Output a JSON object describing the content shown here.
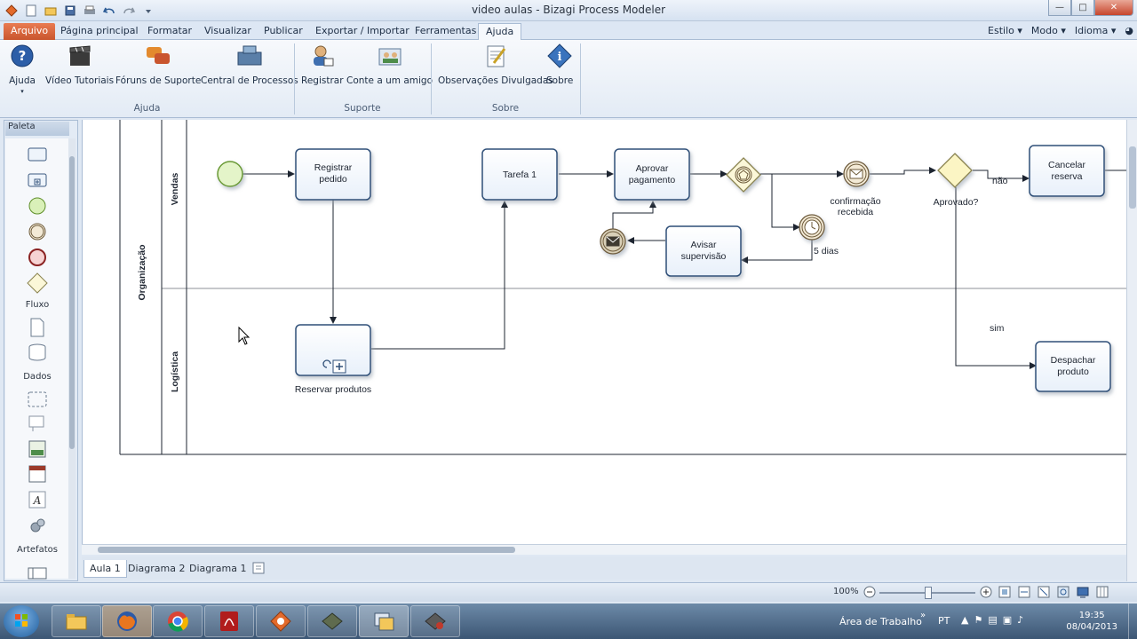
{
  "window": {
    "title": "video aulas - Bizagi Process Modeler"
  },
  "ribbon_tabs": [
    {
      "label": "Arquivo"
    },
    {
      "label": "Página principal"
    },
    {
      "label": "Formatar"
    },
    {
      "label": "Visualizar"
    },
    {
      "label": "Publicar"
    },
    {
      "label": "Exportar / Importar"
    },
    {
      "label": "Ferramentas"
    },
    {
      "label": "Ajuda"
    }
  ],
  "ribbon_right": {
    "estilo": "Estilo",
    "modo": "Modo",
    "idioma": "Idioma"
  },
  "ribbon": {
    "buttons": [
      {
        "label": "Ajuda",
        "icon": "help-icon"
      },
      {
        "label": "Vídeo Tutoriais",
        "icon": "clapperboard-icon"
      },
      {
        "label": "Fóruns de Suporte",
        "icon": "forum-icon"
      },
      {
        "label": "Central de Processos",
        "icon": "process-central-icon"
      },
      {
        "label": "Registrar",
        "icon": "register-user-icon"
      },
      {
        "label": "Conte a um amigo",
        "icon": "tell-friend-icon"
      },
      {
        "label": "Observações Divulgadas",
        "icon": "release-notes-icon"
      },
      {
        "label": "Sobre",
        "icon": "about-icon"
      }
    ],
    "groups": [
      {
        "label": "Ajuda"
      },
      {
        "label": "Suporte"
      },
      {
        "label": "Sobre"
      }
    ]
  },
  "palette": {
    "title": "Paleta",
    "sections": [
      {
        "label": "Fluxo"
      },
      {
        "label": "Dados"
      },
      {
        "label": "Artefatos"
      }
    ]
  },
  "diagram": {
    "pool": "Organização",
    "lanes": [
      {
        "label": "Vendas"
      },
      {
        "label": "Logística"
      }
    ],
    "tasks": {
      "registrar": "Registrar pedido",
      "tarefa1": "Tarefa 1",
      "aprovar": "Aprovar pagamento",
      "avisar": "Avisar supervisão",
      "cancelar": "Cancelar reserva",
      "despachar": "Despachar produto"
    },
    "subprocess_label": "Reservar produtos",
    "events": {
      "confirmacao": "confirmação recebida",
      "timer": "5 dias"
    },
    "gateway_label": "Aprovado?",
    "flow_labels": {
      "nao": "não",
      "sim": "sim"
    }
  },
  "diagram_tabs": [
    {
      "label": "Aula 1"
    },
    {
      "label": "Diagrama 2"
    },
    {
      "label": "Diagrama 1"
    }
  ],
  "statusbar": {
    "zoom": "100%"
  },
  "taskbar": {
    "desktop": "Área de Trabalho",
    "lang": "PT",
    "time": "19:35",
    "date": "08/04/2013"
  }
}
